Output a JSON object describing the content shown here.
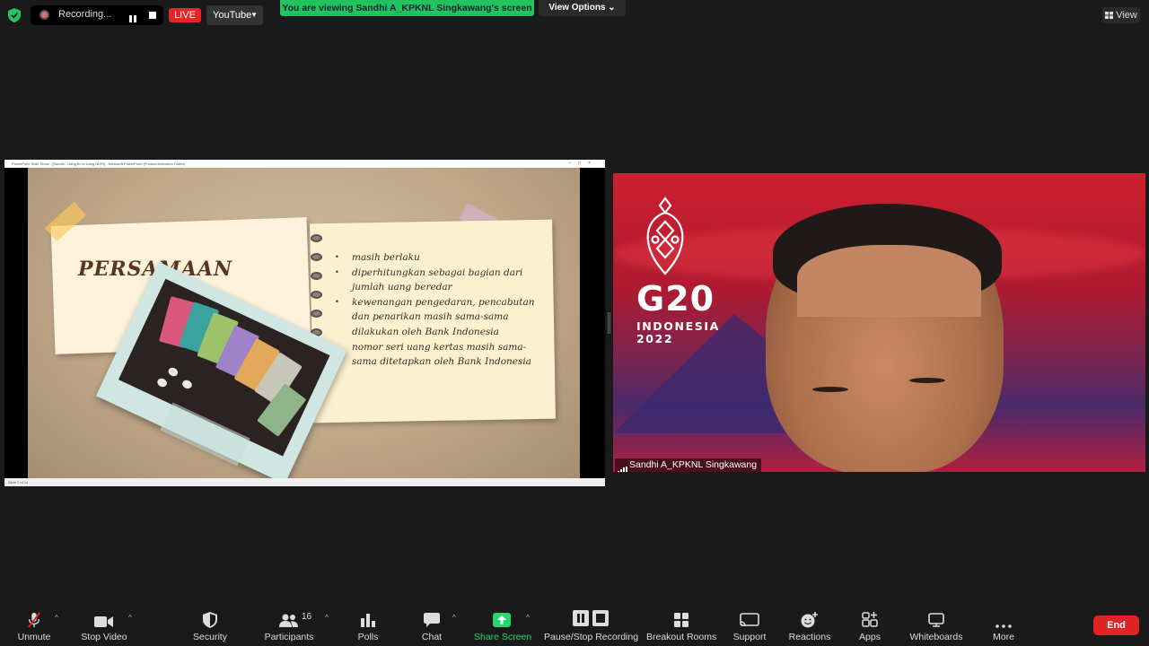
{
  "topbar": {
    "recording_label": "Recording...",
    "live_label": "LIVE",
    "stream_target": "YouTube",
    "share_banner": "You are viewing Sandhi A_KPKNL Singkawang's screen",
    "view_options_label": "View Options",
    "view_label": "View"
  },
  "shared_screen": {
    "window_title": "PowerPoint Slide Show - [Sandhi - Uang Bi vs Uang NKRI] - Microsoft PowerPoint (Product Activation Failed)",
    "status_text": "Slide 2 of 14",
    "slide": {
      "title": "PERSAMAAN",
      "bullets": [
        "masih berlaku",
        "diperhitungkan sebagai bagian dari jumlah uang beredar",
        "kewenangan pengedaran, pencabutan dan penarikan masih sama-sama dilakukan oleh Bank Indonesia",
        "nomor seri uang kertas masih sama-sama ditetapkan oleh Bank Indonesia"
      ]
    }
  },
  "video": {
    "logo_title": "G20",
    "logo_country": "INDONESIA",
    "logo_year": "2022",
    "participant_name": "Sandhi A_KPKNL Singkawang"
  },
  "toolbar": {
    "unmute": "Unmute",
    "stop_video": "Stop Video",
    "security": "Security",
    "participants": "Participants",
    "participants_count": "16",
    "polls": "Polls",
    "chat": "Chat",
    "share_screen": "Share Screen",
    "pause_stop_recording": "Pause/Stop Recording",
    "breakout_rooms": "Breakout Rooms",
    "support": "Support",
    "reactions": "Reactions",
    "apps": "Apps",
    "whiteboards": "Whiteboards",
    "more": "More",
    "end": "End"
  },
  "colors": {
    "share_banner": "#22c25f",
    "live": "#e02828",
    "end": "#e02424",
    "share_active": "#23d96b"
  }
}
